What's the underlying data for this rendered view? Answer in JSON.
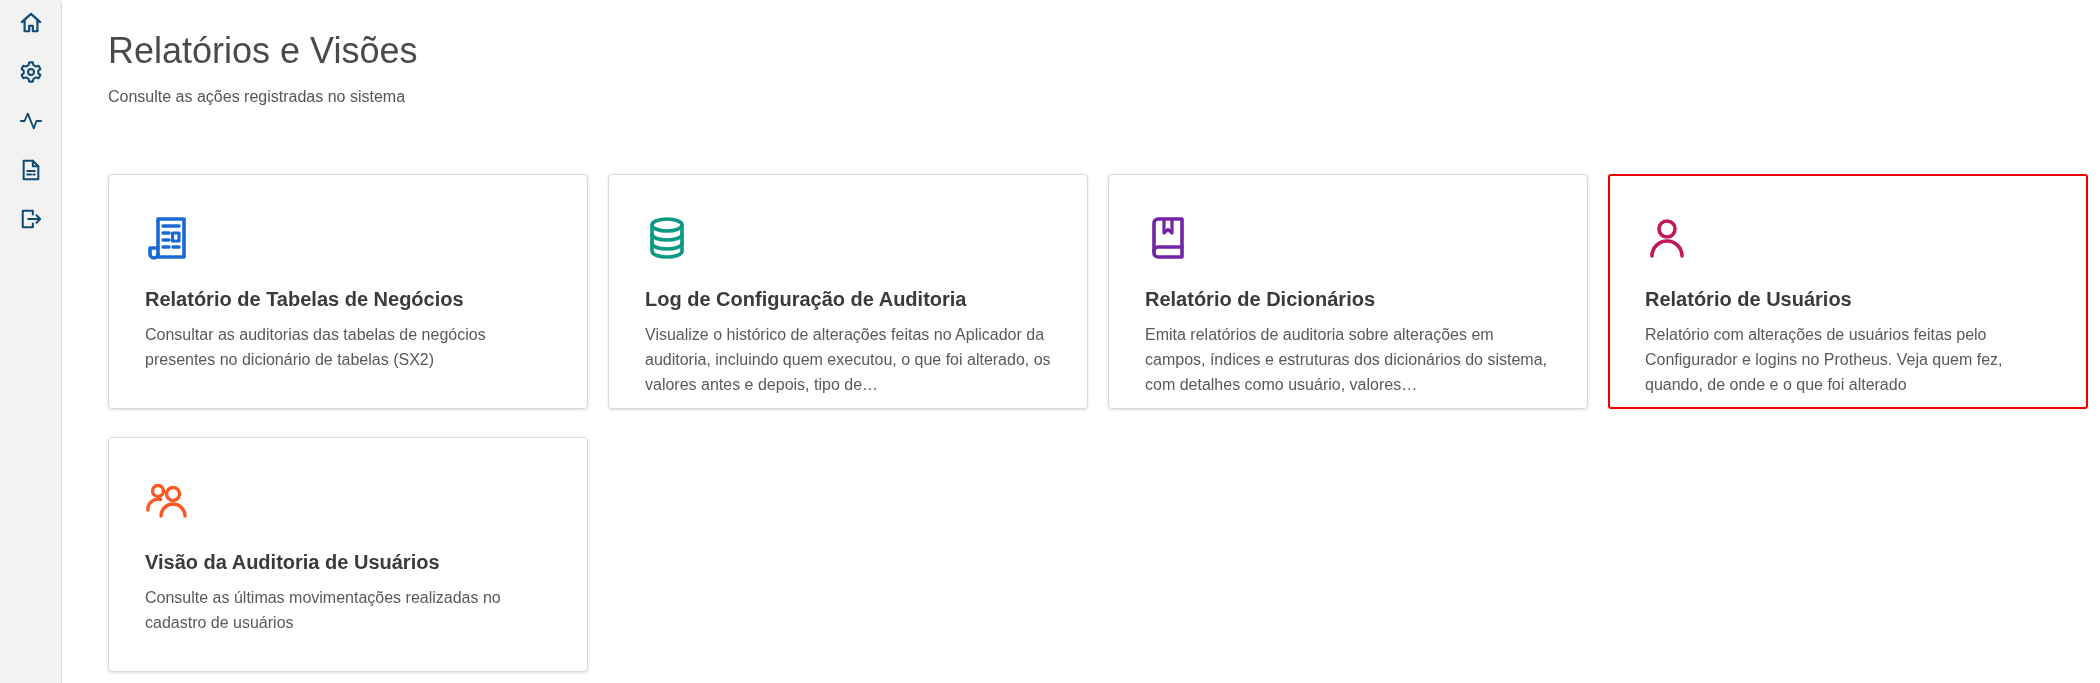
{
  "page": {
    "title": "Relatórios e Visões",
    "subtitle": "Consulte as ações registradas no sistema"
  },
  "cards": [
    {
      "kind": "report",
      "color": "#1a6ad4",
      "title": "Relatório de Tabelas de Negócios",
      "description": "Consultar as auditorias das tabelas de negócios presentes no dicionário de tabelas (SX2)",
      "highlighted": false
    },
    {
      "kind": "database",
      "color": "#0b9984",
      "title": "Log de Configuração de Auditoria",
      "description": "Visualize o histórico de alterações feitas no Aplicador da auditoria, incluindo quem executou, o que foi alterado, os valores antes e depois, tipo de…",
      "highlighted": false
    },
    {
      "kind": "book",
      "color": "#7324a6",
      "title": "Relatório de Dicionários",
      "description": "Emita relatórios de auditoria sobre alterações em campos, índices e estruturas dos dicionários do sistema, com detalhes como usuário, valores…",
      "highlighted": false
    },
    {
      "kind": "user",
      "color": "#c2185b",
      "title": "Relatório de Usuários",
      "description": "Relatório com alterações de usuários feitas pelo Configurador e logins no Protheus. Veja quem fez, quando, de onde e o que foi alterado",
      "highlighted": true
    },
    {
      "kind": "users",
      "color": "#ff5722",
      "title": "Visão da Auditoria de Usuários",
      "description": "Consulte as últimas movimentações realizadas no cadastro de usuários",
      "highlighted": false
    }
  ]
}
